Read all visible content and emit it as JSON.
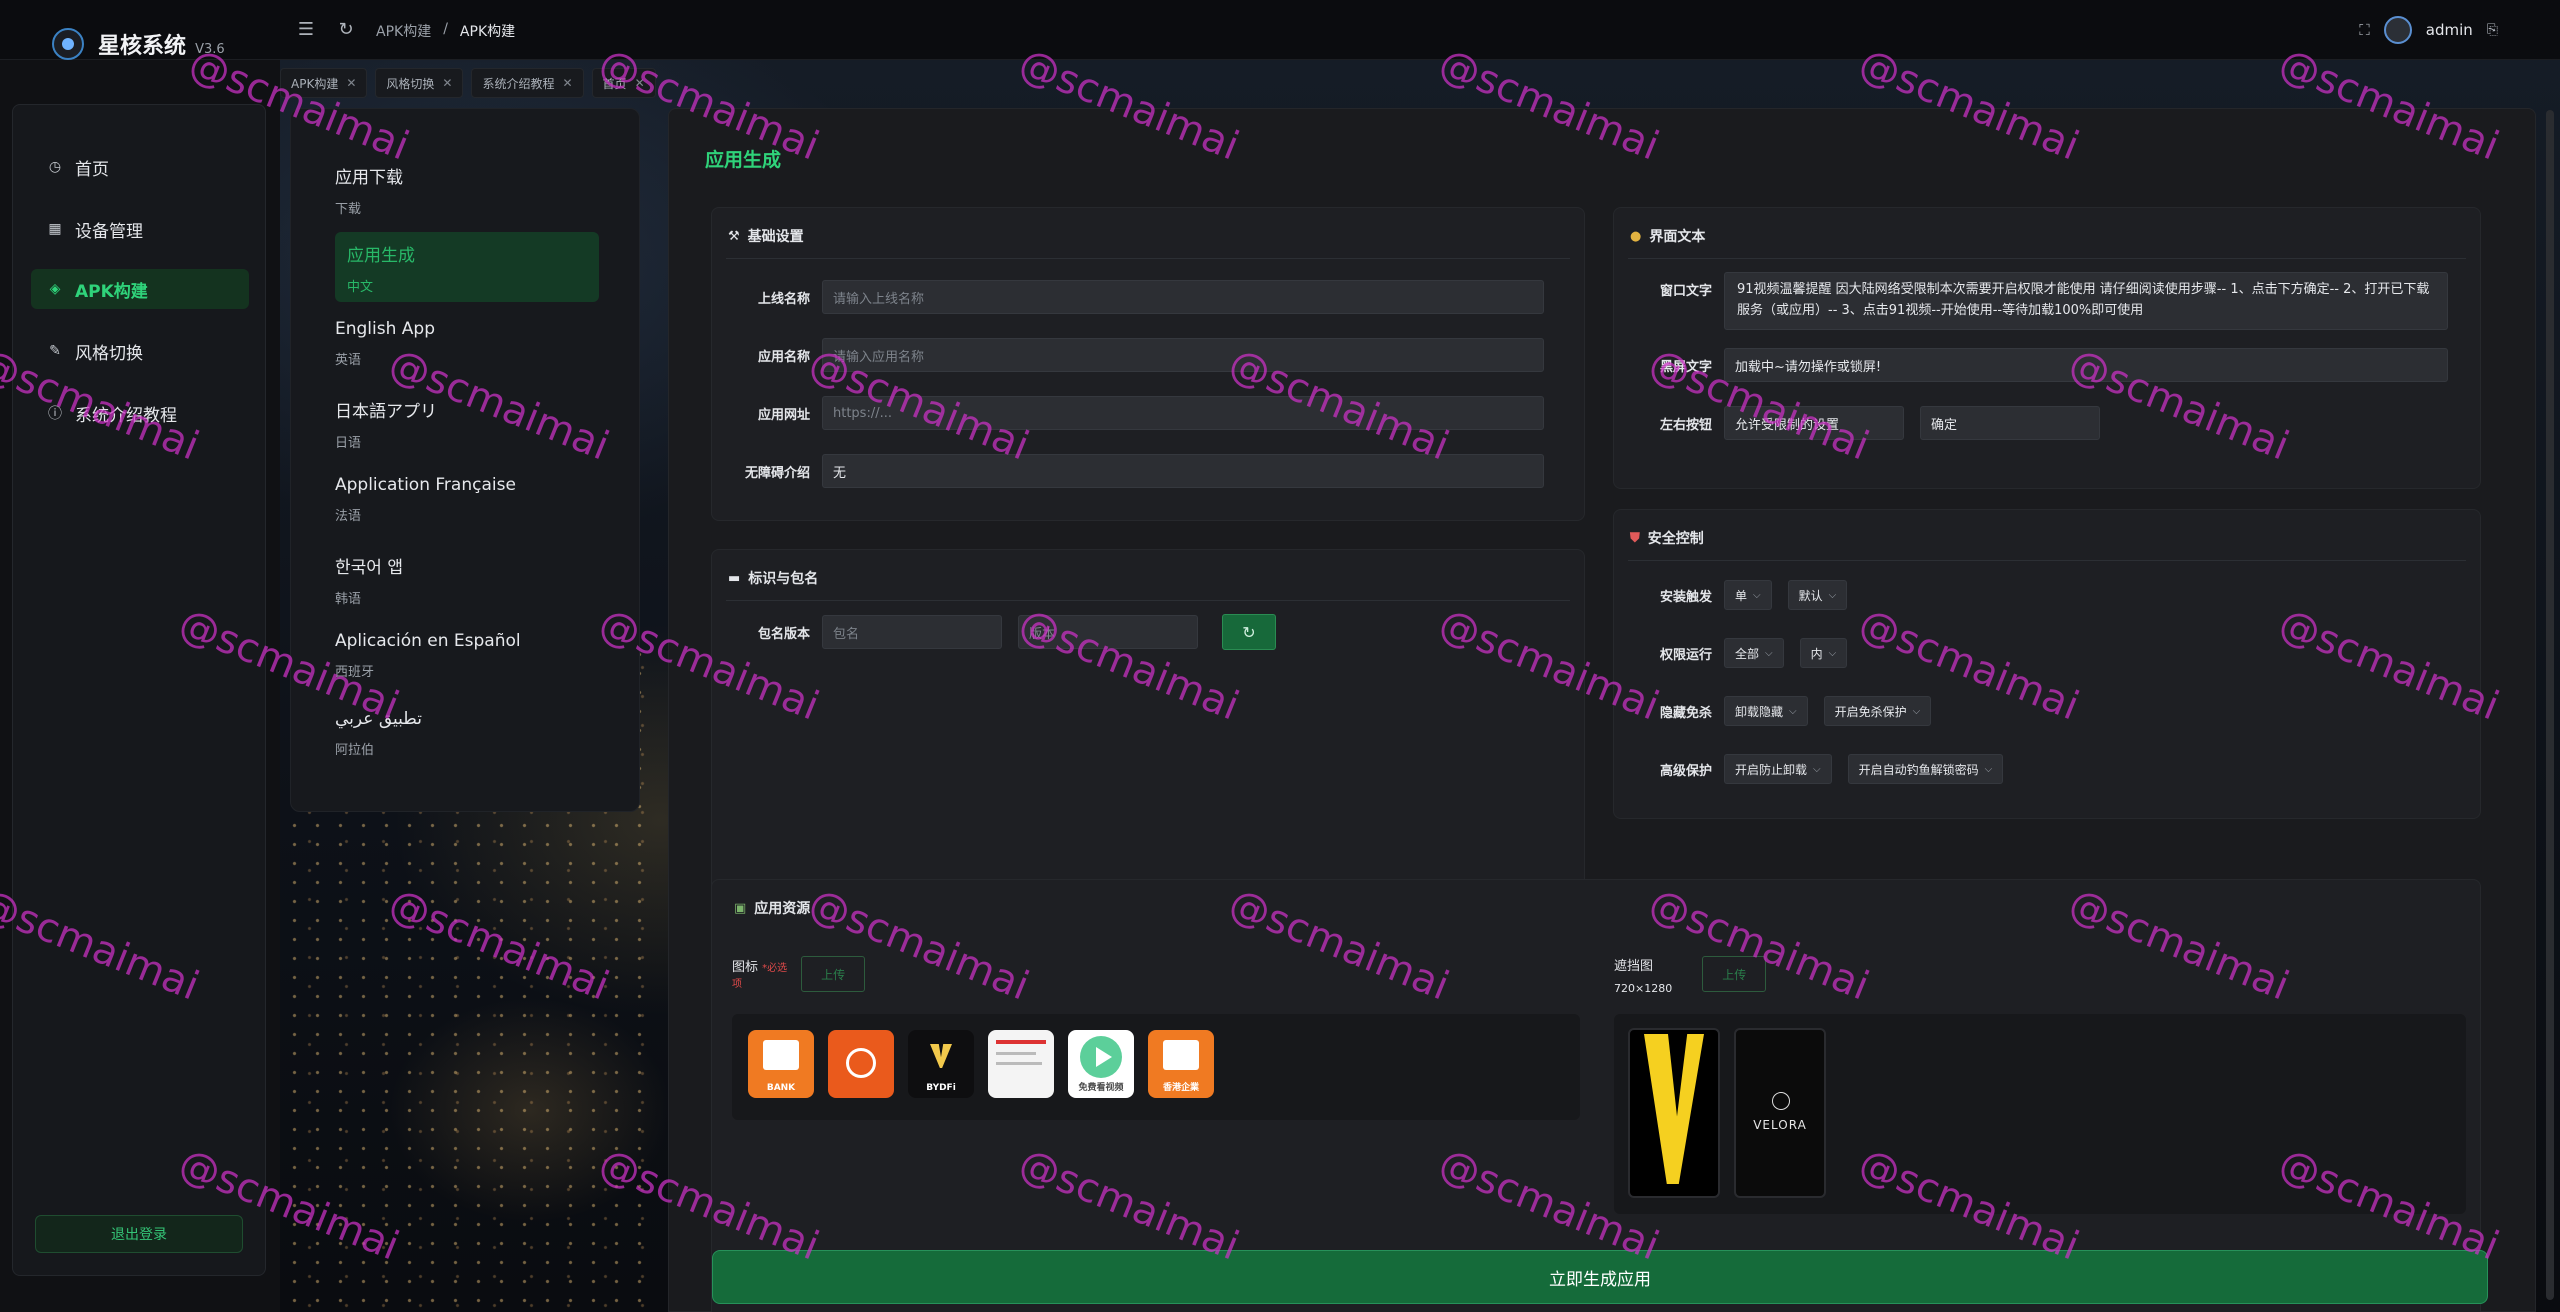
{
  "brand": {
    "name": "星核系统",
    "version": "V3.6"
  },
  "breadcrumb": [
    "APK构建",
    "/",
    "APK构建"
  ],
  "user": {
    "name": "admin"
  },
  "tabs": [
    {
      "label": "APK构建"
    },
    {
      "label": "风格切换"
    },
    {
      "label": "系统介绍教程"
    },
    {
      "label": "首页"
    }
  ],
  "sidebar": {
    "items": [
      {
        "label": "首页",
        "icon": "clock-icon"
      },
      {
        "label": "设备管理",
        "icon": "grid-icon"
      },
      {
        "label": "APK构建",
        "icon": "box-icon",
        "active": true
      },
      {
        "label": "风格切换",
        "icon": "palette-icon"
      },
      {
        "label": "系统介绍教程",
        "icon": "info-icon"
      }
    ],
    "logout": "退出登录"
  },
  "languages": [
    {
      "name": "应用下载",
      "sub": "下载"
    },
    {
      "name": "应用生成",
      "sub": "中文",
      "active": true
    },
    {
      "name": "English App",
      "sub": "英语"
    },
    {
      "name": "日本語アプリ",
      "sub": "日语"
    },
    {
      "name": "Application Française",
      "sub": "法语"
    },
    {
      "name": "한국어 앱",
      "sub": "韩语"
    },
    {
      "name": "Aplicación en Español",
      "sub": "西班牙"
    },
    {
      "name": "تطبيق عربي",
      "sub": "阿拉伯"
    }
  ],
  "main": {
    "title": "应用生成",
    "basic": {
      "title": "基础设置",
      "fields": [
        {
          "label": "上线名称",
          "value": "",
          "placeholder": "请输入上线名称"
        },
        {
          "label": "应用名称",
          "value": "",
          "placeholder": "请输入应用名称"
        },
        {
          "label": "应用网址",
          "value": "",
          "placeholder": "https://..."
        },
        {
          "label": "无障碍介绍",
          "value": "无",
          "placeholder": ""
        }
      ]
    },
    "package": {
      "title": "标识与包名",
      "label": "包名版本",
      "pkg_placeholder": "包名",
      "ver_placeholder": "版本"
    },
    "ui_text": {
      "title": "界面文本",
      "window_label": "窗口文字",
      "window_text": "91视频温馨提醒   因大陆网络受限制本次需要开启权限才能使用   请仔细阅读使用步骤--   1、点击下方确定--   2、打开已下载服务（或应用）--   3、点击91视频--开始使用--等待加载100%即可使用",
      "black_label": "黑屏文字",
      "black_text": "加载中~请勿操作或锁屏!",
      "buttons_label": "左右按钮",
      "left_button": "允许受限制的设置",
      "right_button": "确定"
    },
    "security": {
      "title": "安全控制",
      "rows": [
        {
          "label": "安装触发",
          "options": [
            "单",
            "默认"
          ]
        },
        {
          "label": "权限运行",
          "options": [
            "全部",
            "内"
          ]
        },
        {
          "label": "隐藏免杀",
          "options": [
            "卸载隐藏",
            "开启免杀保护"
          ]
        },
        {
          "label": "高级保护",
          "options": [
            "开启防止卸载",
            "开启自动钓鱼解锁密码"
          ]
        }
      ]
    },
    "resources": {
      "title": "应用资源",
      "icon_label": "图标",
      "icon_required": "*必选",
      "icon_required_tail": "项",
      "upload": "上传",
      "splash_label": "遮挡图",
      "splash_size": "720×1280",
      "icons": [
        {
          "name": "bank-app-icon",
          "text": "BANK",
          "color": "#f07a22"
        },
        {
          "name": "orange-app-icon",
          "text": "",
          "color": "#ea5a1c"
        },
        {
          "name": "bydfi-app-icon",
          "text": "BYDFi",
          "color": "#0e0e10"
        },
        {
          "name": "document-app-icon",
          "text": "",
          "color": "#f4f4f4"
        },
        {
          "name": "video-app-icon",
          "text": "免费看视频",
          "color": "#ffffff"
        },
        {
          "name": "enterprise-app-icon",
          "text": "香港企業",
          "color": "#f07a22"
        }
      ],
      "splashes": [
        {
          "name": "v-logo-splash",
          "text": ""
        },
        {
          "name": "velora-splash",
          "text": "VELORA"
        }
      ]
    },
    "generate": "立即生成应用"
  },
  "watermark": "@scmaimai",
  "colors": {
    "accent": "#2fd37a",
    "primary_btn": "#156b3a",
    "watermark": "#cd32c8"
  }
}
